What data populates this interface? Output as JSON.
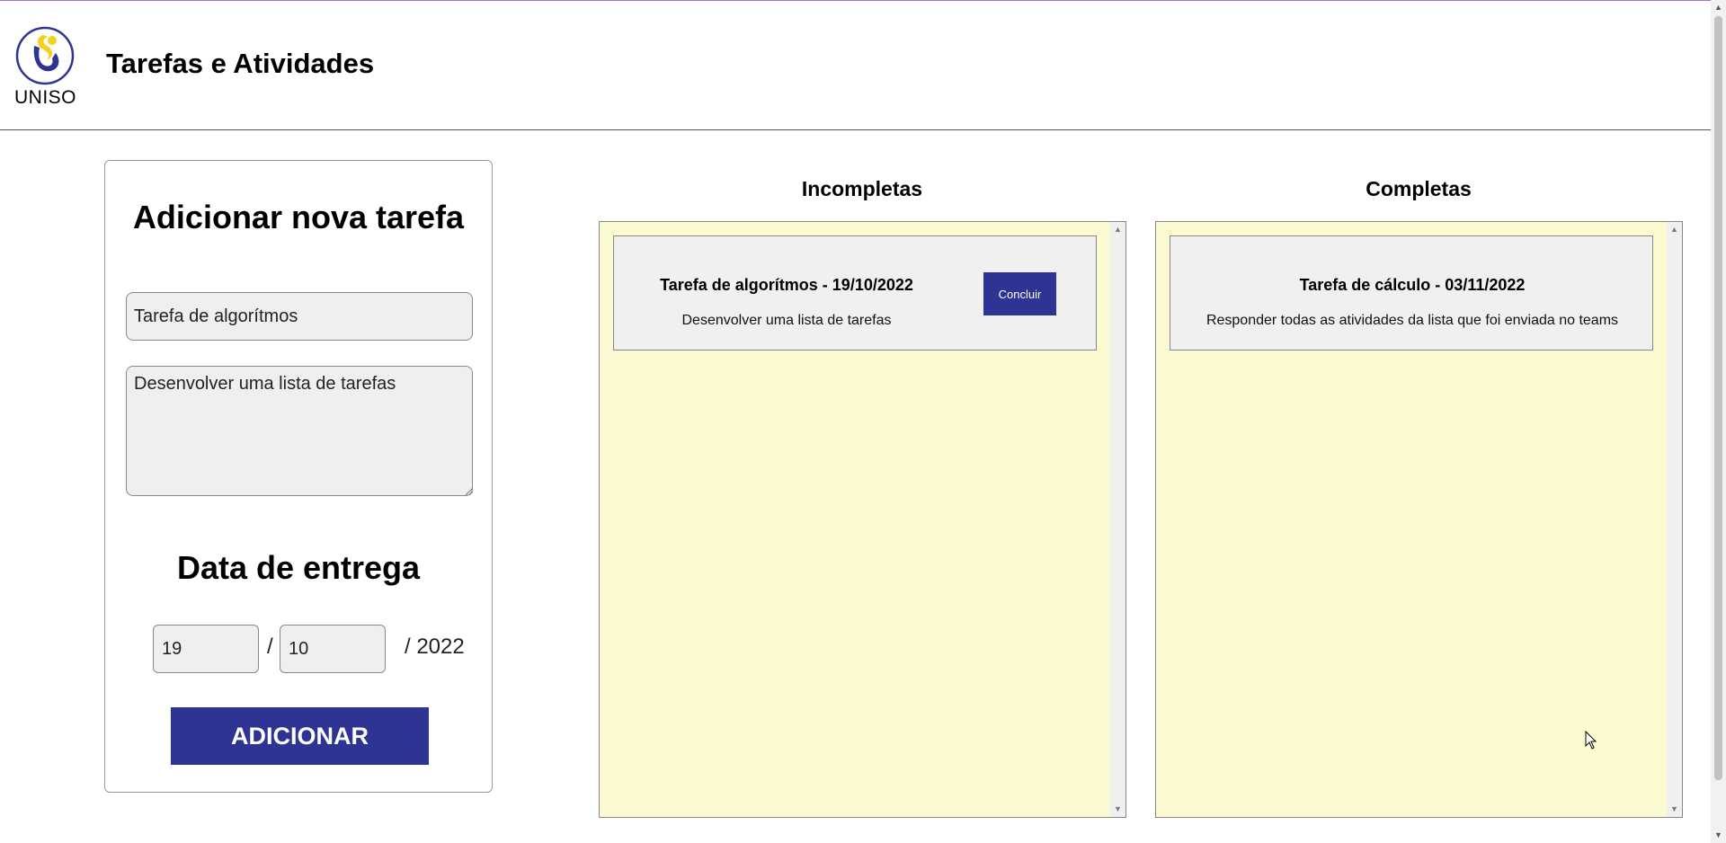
{
  "header": {
    "logo_text": "UNISO",
    "title": "Tarefas e Atividades"
  },
  "form": {
    "title": "Adicionar nova tarefa",
    "task_name_value": "Tarefa de algorítmos",
    "description_value": "Desenvolver uma lista de tarefas",
    "date_title": "Data de entrega",
    "day_value": "19",
    "month_value": "10",
    "date_separator": "/",
    "year_text": "/ 2022",
    "add_button_label": "ADICIONAR"
  },
  "incomplete": {
    "heading": "Incompletas",
    "tasks": [
      {
        "title": "Tarefa de algorítmos - 19/10/2022",
        "description": "Desenvolver uma lista de tarefas",
        "button_label": "Concluir"
      }
    ]
  },
  "complete": {
    "heading": "Completas",
    "tasks": [
      {
        "title": "Tarefa de cálculo - 03/11/2022",
        "description": "Responder todas as atividades da lista que foi enviada no teams"
      }
    ]
  },
  "colors": {
    "accent": "#2d3494",
    "panel_bg": "#fcfad0",
    "card_bg": "#f0f0f0",
    "logo_yellow": "#f2d21c"
  }
}
